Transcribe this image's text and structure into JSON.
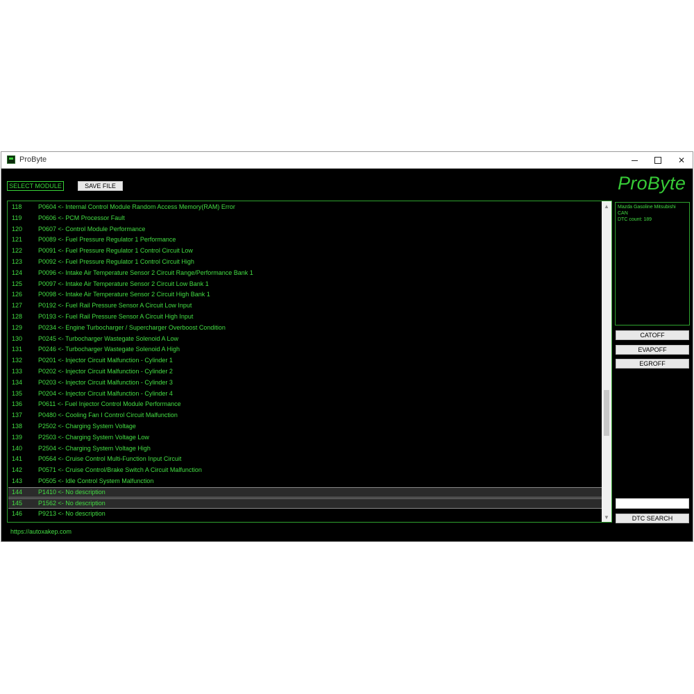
{
  "window": {
    "title": "ProByte",
    "minimize": "—",
    "maximize": "☐",
    "close": "✕"
  },
  "toolbar": {
    "select_module": "SELECT MODULE",
    "save_file": "SAVE FILE"
  },
  "logo": "ProByte",
  "info": {
    "lines": [
      "Mazda Gasoline Mitsubishi",
      "CAN",
      "DTC count: 189"
    ]
  },
  "buttons": {
    "catoff": "CATOFF",
    "evapoff": "EVAPOFF",
    "egroff": "EGROFF",
    "dtc_search": "DTC SEARCH"
  },
  "search": {
    "value": ""
  },
  "footer": {
    "url": "https://autoxakep.com"
  },
  "scrollbar": {
    "position_fraction": 0.7
  },
  "dtc_list": [
    {
      "num": "118",
      "text": "P0604 <- Internal Control Module Random Access Memory(RAM) Error",
      "selected": false
    },
    {
      "num": "119",
      "text": "P0606 <- PCM Processor Fault",
      "selected": false
    },
    {
      "num": "120",
      "text": "P0607 <- Control Module Performance",
      "selected": false
    },
    {
      "num": "121",
      "text": "P0089 <- Fuel Pressure Regulator 1 Performance",
      "selected": false
    },
    {
      "num": "122",
      "text": "P0091 <- Fuel Pressure Regulator 1 Control Circuit Low",
      "selected": false
    },
    {
      "num": "123",
      "text": "P0092 <- Fuel Pressure Regulator 1 Control Circuit High",
      "selected": false
    },
    {
      "num": "124",
      "text": "P0096 <- Intake Air Temperature Sensor 2 Circuit Range/Performance Bank 1",
      "selected": false
    },
    {
      "num": "125",
      "text": "P0097 <- Intake Air Temperature Sensor 2 Circuit Low Bank 1",
      "selected": false
    },
    {
      "num": "126",
      "text": "P0098 <- Intake Air Temperature Sensor 2 Circuit High Bank 1",
      "selected": false
    },
    {
      "num": "127",
      "text": "P0192 <- Fuel Rail Pressure Sensor A Circuit Low Input",
      "selected": false
    },
    {
      "num": "128",
      "text": "P0193 <- Fuel Rail Pressure Sensor A Circuit High Input",
      "selected": false
    },
    {
      "num": "129",
      "text": "P0234 <- Engine Turbocharger / Supercharger Overboost Condition",
      "selected": false
    },
    {
      "num": "130",
      "text": "P0245 <- Turbocharger Wastegate Solenoid A Low",
      "selected": false
    },
    {
      "num": "131",
      "text": "P0246 <- Turbocharger Wastegate Solenoid A High",
      "selected": false
    },
    {
      "num": "132",
      "text": "P0201 <- Injector Circuit Malfunction - Cylinder 1",
      "selected": false
    },
    {
      "num": "133",
      "text": "P0202 <- Injector Circuit Malfunction - Cylinder 2",
      "selected": false
    },
    {
      "num": "134",
      "text": "P0203 <- Injector Circuit Malfunction - Cylinder 3",
      "selected": false
    },
    {
      "num": "135",
      "text": "P0204 <- Injector Circuit Malfunction - Cylinder 4",
      "selected": false
    },
    {
      "num": "136",
      "text": "P0611 <- Fuel Injector Control Module Performance",
      "selected": false
    },
    {
      "num": "137",
      "text": "P0480 <- Cooling Fan I Control Circuit Malfunction",
      "selected": false
    },
    {
      "num": "138",
      "text": "P2502 <- Charging System Voltage",
      "selected": false
    },
    {
      "num": "139",
      "text": "P2503 <- Charging System Voltage Low",
      "selected": false
    },
    {
      "num": "140",
      "text": "P2504 <- Charging System Voltage High",
      "selected": false
    },
    {
      "num": "141",
      "text": "P0564 <- Cruise Control Multi-Function Input Circuit",
      "selected": false
    },
    {
      "num": "142",
      "text": "P0571 <- Cruise Control/Brake Switch A Circuit Malfunction",
      "selected": false
    },
    {
      "num": "143",
      "text": "P0505 <- Idle Control System Malfunction",
      "selected": false
    },
    {
      "num": "144",
      "text": "P1410 <- No description",
      "selected": true
    },
    {
      "num": "145",
      "text": "P1562 <- No description",
      "selected": true
    },
    {
      "num": "146",
      "text": "P9213 <- No description",
      "selected": false
    }
  ],
  "colors": {
    "accent": "#43de43",
    "background": "#000000",
    "selected_row": "#2b2b2b"
  }
}
